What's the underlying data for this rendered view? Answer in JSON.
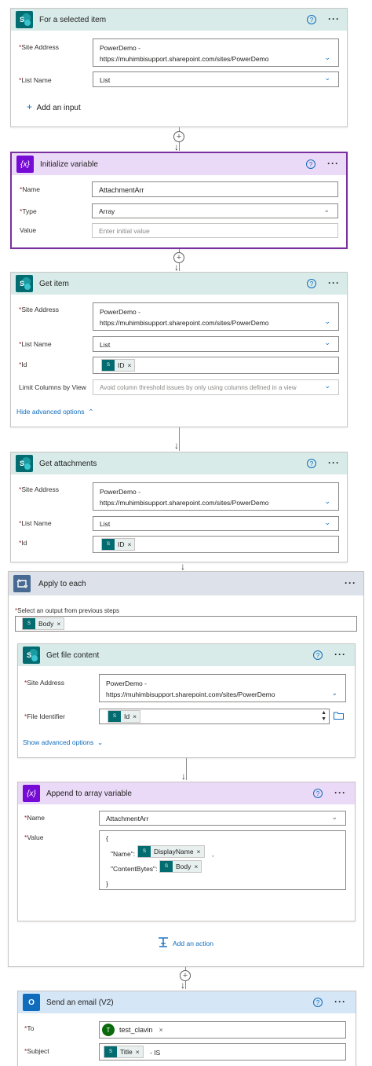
{
  "card1": {
    "title": "For a selected item",
    "site_label": "Site Address",
    "site_value_1": "PowerDemo -",
    "site_value_2": "https://muhimbisupport.sharepoint.com/sites/PowerDemo",
    "list_label": "List Name",
    "list_value": "List",
    "add_input": "Add an input"
  },
  "card2": {
    "title": "Initialize variable",
    "name_label": "Name",
    "name_value": "AttachmentArr",
    "type_label": "Type",
    "type_value": "Array",
    "value_label": "Value",
    "value_placeholder": "Enter initial value"
  },
  "card3": {
    "title": "Get item",
    "site_label": "Site Address",
    "site_value_1": "PowerDemo -",
    "site_value_2": "https://muhimbisupport.sharepoint.com/sites/PowerDemo",
    "list_label": "List Name",
    "list_value": "List",
    "id_label": "Id",
    "id_token": "ID",
    "limit_label": "Limit Columns by View",
    "limit_placeholder": "Avoid column threshold issues by only using columns defined in a view",
    "hide_advanced": "Hide advanced options"
  },
  "card4": {
    "title": "Get attachments",
    "site_label": "Site Address",
    "site_value_1": "PowerDemo -",
    "site_value_2": "https://muhimbisupport.sharepoint.com/sites/PowerDemo",
    "list_label": "List Name",
    "list_value": "List",
    "id_label": "Id",
    "id_token": "ID"
  },
  "apply": {
    "title": "Apply to each",
    "select_label": "Select an output from previous steps",
    "body_token": "Body",
    "add_action": "Add an action"
  },
  "getfile": {
    "title": "Get file content",
    "site_label": "Site Address",
    "site_value_1": "PowerDemo -",
    "site_value_2": "https://muhimbisupport.sharepoint.com/sites/PowerDemo",
    "file_label": "File Identifier",
    "id_token": "Id",
    "show_advanced": "Show advanced options"
  },
  "append": {
    "title": "Append to array variable",
    "name_label": "Name",
    "name_value": "AttachmentArr",
    "value_label": "Value",
    "line_open": "{",
    "name_key": "\"Name\":",
    "displayname_token": "DisplayName",
    "comma": ",",
    "bytes_key": "\"ContentBytes\":",
    "body_token": "Body",
    "line_close": "}"
  },
  "email": {
    "title": "Send an email (V2)",
    "to_label": "To",
    "to_value": "test_clavin",
    "to_avatar": "T",
    "subject_label": "Subject",
    "title_token": "Title",
    "subject_suffix": "- IS"
  },
  "common": {
    "required_mark": "*",
    "help_glyph": "?",
    "more_glyph": "···",
    "token_remove": "×"
  },
  "colors": {
    "sharepoint_header": "#d8ebe9",
    "variable_header": "#ebdaf7",
    "control_header": "#dde1ea",
    "outlook_header": "#d5e6f6",
    "accent_blue": "#0f6cbd",
    "selected_border": "#7a2f9e"
  }
}
